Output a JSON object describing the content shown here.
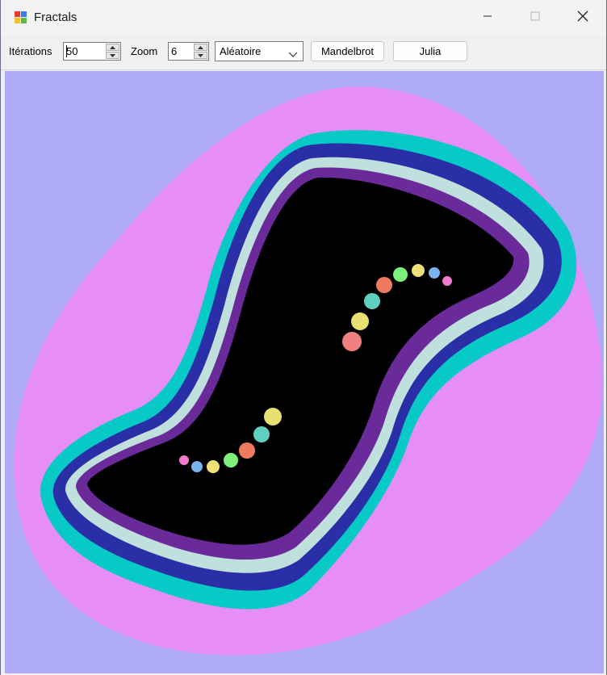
{
  "window": {
    "title": "Fractals",
    "icon": "app-fractal-icon",
    "controls": [
      "minimize-icon",
      "maximize-icon",
      "close-icon"
    ]
  },
  "toolbar": {
    "iterations_label": "Itérations",
    "iterations_value": "50",
    "zoom_label": "Zoom",
    "zoom_value": "6",
    "palette_selected": "Aléatoire",
    "mandelbrot_label": "Mandelbrot",
    "julia_label": "Julia"
  },
  "canvas": {
    "kind": "julia-set-render",
    "colors": {
      "background": "#afaaf5",
      "outer": "#e68ef5",
      "teal": "#07c9c5",
      "navy": "#2a2fa8",
      "pale": "#bfe0dc",
      "inner": "#000000"
    }
  }
}
